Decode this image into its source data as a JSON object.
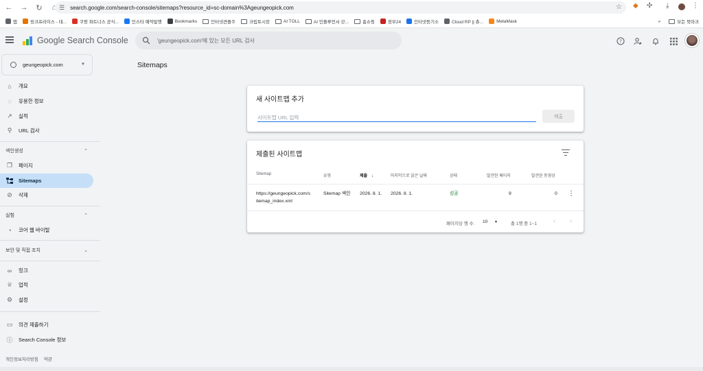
{
  "browser": {
    "url": "search.google.com/search-console/sitemaps?resource_id=sc-domain%3Ageungeopick.com",
    "bookmarks": [
      {
        "label": "앱",
        "color": "#5f6368",
        "folder": false
      },
      {
        "label": "링크프라이스 - 대...",
        "color": "#e37400",
        "folder": false
      },
      {
        "label": "쿠팡 파트너스 공식...",
        "color": "#d93025",
        "folder": false
      },
      {
        "label": "인스타 예약발행",
        "color": "#1877f2",
        "folder": false
      },
      {
        "label": "Bookmarks",
        "color": "#3c4043",
        "folder": false
      },
      {
        "label": "인터넷견플주",
        "color": "",
        "folder": true
      },
      {
        "label": "크립토시장",
        "color": "",
        "folder": true
      },
      {
        "label": "AI TOLL",
        "color": "",
        "folder": true
      },
      {
        "label": "AI 인플루언서 강...",
        "color": "",
        "folder": true
      },
      {
        "label": "홈쇼핑",
        "color": "",
        "folder": true
      },
      {
        "label": "정부24",
        "color": "#c5221f",
        "folder": false
      },
      {
        "label": "인터넷등기소",
        "color": "#1a73e8",
        "folder": false
      },
      {
        "label": "Cloud RP || 츄...",
        "color": "#5f6368",
        "folder": false
      },
      {
        "label": "MetaMask",
        "color": "#f6851b",
        "folder": false
      }
    ],
    "more_bookmarks": "»",
    "all_bookmarks": "모든 북마크"
  },
  "app": {
    "brand": "Google Search Console",
    "search_placeholder": "'geungeopick.com'에 있는 모든 URL 검사"
  },
  "sidebar": {
    "property": "geungeopick.com",
    "items_top": [
      {
        "label": "개요",
        "icon": "home-icon"
      },
      {
        "label": "유용한 정보",
        "icon": "lightbulb-icon"
      },
      {
        "label": "실적",
        "icon": "trending-icon"
      },
      {
        "label": "URL 검사",
        "icon": "search-icon"
      }
    ],
    "section_index": "색인생성",
    "items_index": [
      {
        "label": "페이지",
        "icon": "pages-icon",
        "active": false
      },
      {
        "label": "Sitemaps",
        "icon": "sitemap-icon",
        "active": true
      },
      {
        "label": "삭제",
        "icon": "removal-icon",
        "active": false
      }
    ],
    "section_experience": "실험",
    "items_experience": [
      {
        "label": "코어 웹 바이탈",
        "icon": "gauge-icon"
      }
    ],
    "section_security": "보안 및 직접 조치",
    "items_bottom": [
      {
        "label": "링크",
        "icon": "link-icon"
      },
      {
        "label": "업적",
        "icon": "trophy-icon"
      },
      {
        "label": "설정",
        "icon": "gear-icon"
      }
    ],
    "items_footer": [
      {
        "label": "의견 제출하기",
        "icon": "feedback-icon"
      },
      {
        "label": "Search Console 정보",
        "icon": "info-icon"
      }
    ],
    "footer_links": [
      "개인정보처리방침",
      "약관"
    ]
  },
  "main": {
    "title": "Sitemaps",
    "add_card": {
      "title": "새 사이트맵 추가",
      "input_placeholder": "사이트맵 URL 입력",
      "input_value": "",
      "submit_label": "제출"
    },
    "submitted_card": {
      "title": "제출된 사이트맵",
      "columns": [
        "Sitemap",
        "유형",
        "제출",
        "마지막으로 읽은 날짜",
        "상태",
        "발견된 페이지",
        "발견된 동영상"
      ],
      "sort_arrow": "↓",
      "rows": [
        {
          "sitemap_line1": "https://geungeopick.com/s",
          "sitemap_line2": "itemap_index.xml",
          "type": "Sitemap 색인",
          "submitted": "2026. 8. 1.",
          "last_read": "2026. 8. 1.",
          "status": "성공",
          "pages": "9",
          "videos": "0"
        }
      ],
      "pager": {
        "rows_per_page_label": "페이지당 행 수:",
        "rows_per_page": "10",
        "range": "총 1행 중 1~1"
      }
    }
  }
}
